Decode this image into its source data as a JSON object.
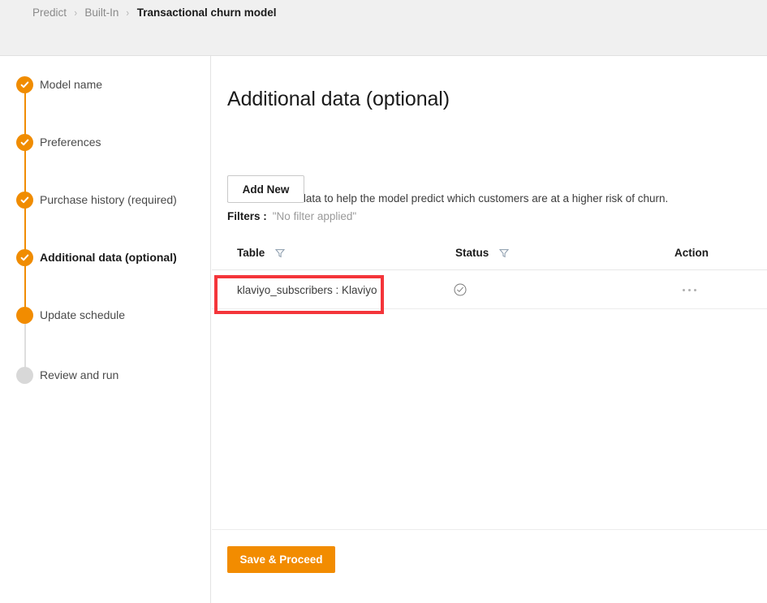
{
  "breadcrumb": {
    "items": [
      {
        "label": "Predict",
        "current": false
      },
      {
        "label": "Built-In",
        "current": false
      },
      {
        "label": "Transactional churn model",
        "current": true
      }
    ],
    "separator": "›"
  },
  "sidebar": {
    "steps": [
      {
        "label": "Model name",
        "state": "done"
      },
      {
        "label": "Preferences",
        "state": "done"
      },
      {
        "label": "Purchase history (required)",
        "state": "done"
      },
      {
        "label": "Additional data (optional)",
        "state": "current"
      },
      {
        "label": "Update schedule",
        "state": "active"
      },
      {
        "label": "Review and run",
        "state": "pending"
      }
    ]
  },
  "main": {
    "title": "Additional data (optional)",
    "description": "Add additional data to help the model predict which customers are at a higher risk of churn.",
    "add_new_label": "Add New",
    "filters": {
      "label": "Filters :",
      "value": "\"No filter applied\""
    },
    "table": {
      "columns": [
        {
          "key": "table",
          "label": "Table",
          "has_filter": true
        },
        {
          "key": "status",
          "label": "Status",
          "has_filter": true
        },
        {
          "key": "action",
          "label": "Action",
          "has_filter": false
        }
      ],
      "rows": [
        {
          "table": "klaviyo_subscribers : Klaviyo",
          "status_icon": "check-circle-icon",
          "action_icon": "ellipsis-icon",
          "highlighted": true
        }
      ]
    },
    "save_label": "Save & Proceed"
  },
  "colors": {
    "accent_orange": "#f28c00",
    "highlight_red": "#f4353a",
    "header_bg": "#f0f0f0",
    "pending_gray": "#d8d8d8"
  }
}
